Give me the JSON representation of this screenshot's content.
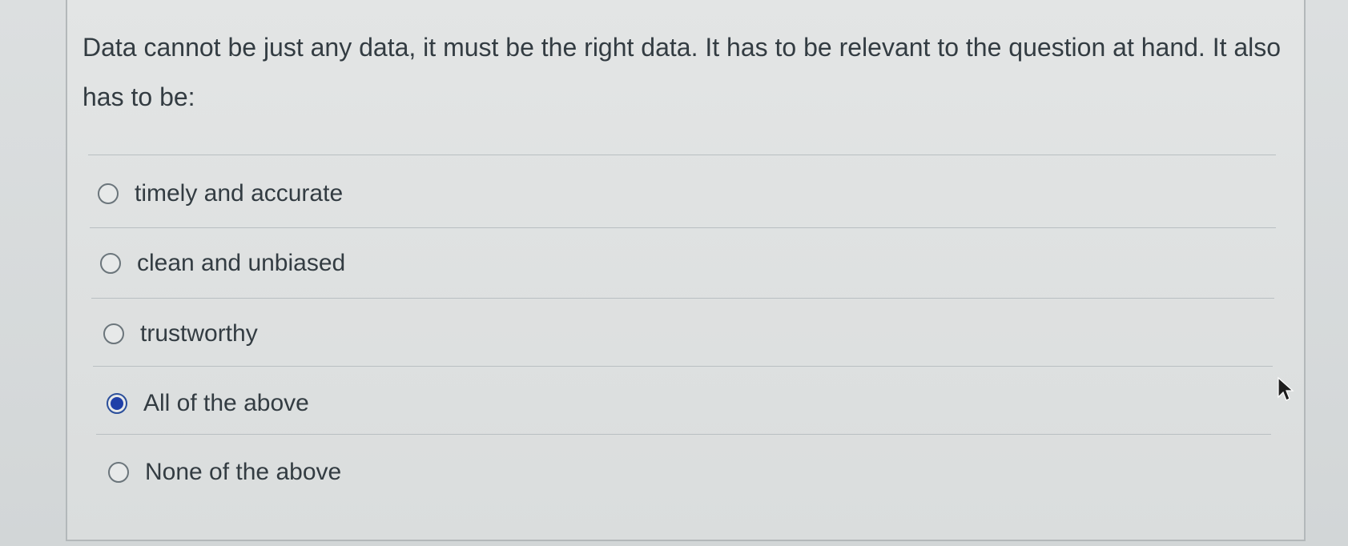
{
  "question": {
    "text": "Data cannot be just any data, it must be the right data. It has to be relevant to the question at hand. It also has to be:"
  },
  "answers": [
    {
      "label": "timely and accurate",
      "selected": false
    },
    {
      "label": "clean and unbiased",
      "selected": false
    },
    {
      "label": "trustworthy",
      "selected": false
    },
    {
      "label": "All of the above",
      "selected": true
    },
    {
      "label": "None of the above",
      "selected": false
    }
  ],
  "colors": {
    "selected_radio": "#1f3fa8",
    "text": "#333c42"
  },
  "icons": {
    "cursor": "arrow-cursor-icon"
  }
}
